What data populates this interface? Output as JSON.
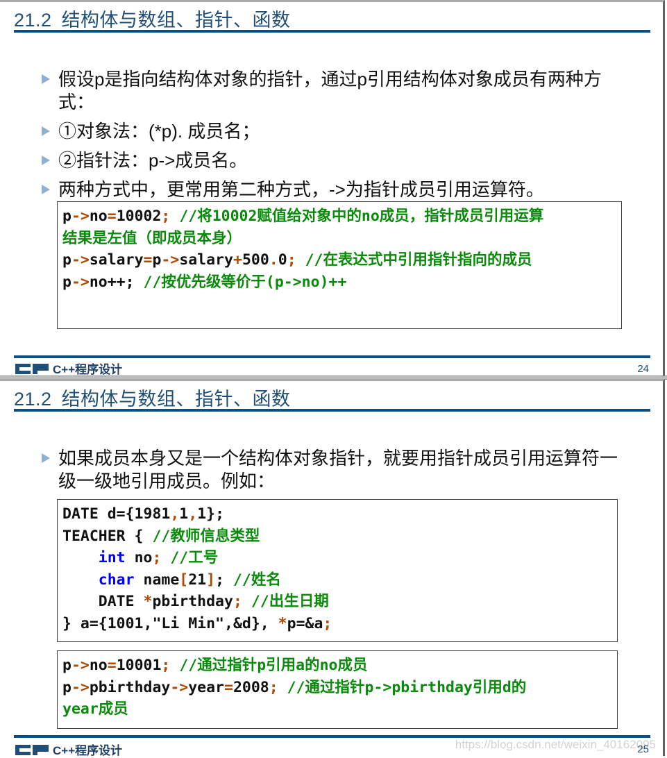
{
  "slides": [
    {
      "title_number": "21.2",
      "title_text": "结构体与数组、指针、函数",
      "bullets": [
        "假设p是指向结构体对象的指针，通过p引用结构体对象成员有两种方式：",
        "①对象法：(*p). 成员名；",
        "②指针法：p->成员名。",
        "两种方式中，更常用第二种方式，->为指针成员引用运算符。"
      ],
      "code_block": {
        "lines": [
          [
            {
              "t": "p",
              "s": "n"
            },
            {
              "t": "->",
              "s": "o"
            },
            {
              "t": "no",
              "s": "n"
            },
            {
              "t": "=",
              "s": "o"
            },
            {
              "t": "10002",
              "s": "n"
            },
            {
              "t": "; ",
              "s": "o"
            },
            {
              "t": "//将10002赋值给对象中的no成员，指针成员引用运算",
              "s": "c"
            }
          ],
          [
            {
              "t": "结果是左值（即成员本身）",
              "s": "c"
            }
          ],
          [
            {
              "t": "p",
              "s": "n"
            },
            {
              "t": "->",
              "s": "o"
            },
            {
              "t": "salary",
              "s": "n"
            },
            {
              "t": "=",
              "s": "o"
            },
            {
              "t": "p",
              "s": "n"
            },
            {
              "t": "->",
              "s": "o"
            },
            {
              "t": "salary",
              "s": "n"
            },
            {
              "t": "+",
              "s": "o"
            },
            {
              "t": "500",
              "s": "n"
            },
            {
              "t": ".",
              "s": "o"
            },
            {
              "t": "0",
              "s": "n"
            },
            {
              "t": "; ",
              "s": "o"
            },
            {
              "t": "//在表达式中引用指针指向的成员",
              "s": "c"
            }
          ],
          [
            {
              "t": "p",
              "s": "n"
            },
            {
              "t": "->",
              "s": "o"
            },
            {
              "t": "no++; ",
              "s": "n"
            },
            {
              "t": "//按优先级等价于(p->no)++",
              "s": "c"
            }
          ]
        ]
      },
      "footer_logo_text": "C++程序设计",
      "page_number": "24"
    },
    {
      "title_number": "21.2",
      "title_text": "结构体与数组、指针、函数",
      "bullets": [
        "如果成员本身又是一个结构体对象指针，就要用指针成员引用运算符一级一级地引用成员。例如："
      ],
      "code_block_1": {
        "lines": [
          [
            {
              "t": "DATE d={1981",
              "s": "n"
            },
            {
              "t": ",",
              "s": "o"
            },
            {
              "t": "1",
              "s": "n"
            },
            {
              "t": ",",
              "s": "o"
            },
            {
              "t": "1};",
              "s": "n"
            }
          ],
          [
            {
              "t": "TEACHER { ",
              "s": "n"
            },
            {
              "t": "//教师信息类型",
              "s": "c"
            }
          ],
          [
            {
              "t": "    ",
              "s": "n"
            },
            {
              "t": "int",
              "s": "k"
            },
            {
              "t": " no",
              "s": "n"
            },
            {
              "t": "; ",
              "s": "o"
            },
            {
              "t": "//工号",
              "s": "c"
            }
          ],
          [
            {
              "t": "    ",
              "s": "n"
            },
            {
              "t": "char",
              "s": "k"
            },
            {
              "t": " name",
              "s": "n"
            },
            {
              "t": "[",
              "s": "o"
            },
            {
              "t": "21",
              "s": "n"
            },
            {
              "t": "]",
              "s": "o"
            },
            {
              "t": "; ",
              "s": "n"
            },
            {
              "t": "//姓名",
              "s": "c"
            }
          ],
          [
            {
              "t": "    DATE ",
              "s": "n"
            },
            {
              "t": "*",
              "s": "o"
            },
            {
              "t": "pbirthday",
              "s": "n"
            },
            {
              "t": "; ",
              "s": "o"
            },
            {
              "t": "//出生日期",
              "s": "c"
            }
          ],
          [
            {
              "t": "} a={1001,\"Li Min\",&d}, ",
              "s": "n"
            },
            {
              "t": "*",
              "s": "o"
            },
            {
              "t": "p=&a",
              "s": "n"
            },
            {
              "t": ";",
              "s": "o"
            }
          ]
        ]
      },
      "code_block_2": {
        "lines": [
          [
            {
              "t": "p",
              "s": "n"
            },
            {
              "t": "->",
              "s": "o"
            },
            {
              "t": "no",
              "s": "n"
            },
            {
              "t": "=",
              "s": "o"
            },
            {
              "t": "10001",
              "s": "n"
            },
            {
              "t": "; ",
              "s": "o"
            },
            {
              "t": "//通过指针p引用a的no成员",
              "s": "c"
            }
          ],
          [
            {
              "t": "p",
              "s": "n"
            },
            {
              "t": "->",
              "s": "o"
            },
            {
              "t": "pbirthday",
              "s": "n"
            },
            {
              "t": "->",
              "s": "o"
            },
            {
              "t": "year",
              "s": "n"
            },
            {
              "t": "=",
              "s": "o"
            },
            {
              "t": "2008",
              "s": "n"
            },
            {
              "t": "; ",
              "s": "o"
            },
            {
              "t": "//通过指针p->pbirthday引用d的",
              "s": "c"
            }
          ],
          [
            {
              "t": "year成员",
              "s": "c"
            }
          ]
        ]
      },
      "footer_logo_text": "C++程序设计",
      "page_number": "25",
      "watermark": "https://blog.csdn.net/weixin_40162095"
    }
  ],
  "colors": {
    "title": "#1f4e79",
    "rule": "#0b4f85",
    "bullet_marker": "#8fb0cf",
    "code_keyword": "#0000ff",
    "code_operator": "#b14a00",
    "code_comment": "#0a8a0a"
  },
  "icons": {
    "bullet": "triangle-right-icon",
    "logo": "cp-logo-icon"
  }
}
